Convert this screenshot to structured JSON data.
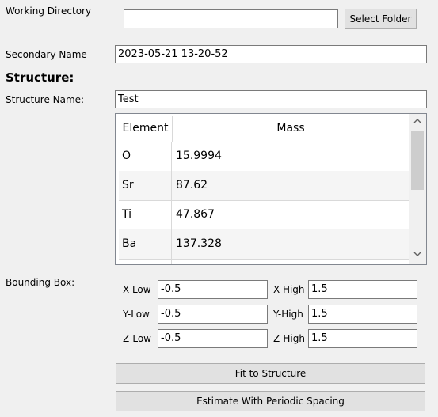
{
  "working_directory": {
    "label": "Working Directory",
    "value": "",
    "button": "Select Folder"
  },
  "secondary_name": {
    "label": "Secondary Name",
    "value": "2023-05-21 13-20-52"
  },
  "structure": {
    "heading": "Structure:",
    "name_label": "Structure Name:",
    "name_value": "Test",
    "table": {
      "headers": [
        "Element",
        "Mass"
      ],
      "rows": [
        {
          "element": "O",
          "mass": "15.9994"
        },
        {
          "element": "Sr",
          "mass": "87.62"
        },
        {
          "element": "Ti",
          "mass": "47.867"
        },
        {
          "element": "Ba",
          "mass": "137.328"
        }
      ],
      "icons": {
        "up": "chevron-up-icon",
        "down": "chevron-down-icon"
      }
    }
  },
  "bounding_box": {
    "label": "Bounding Box:",
    "x_low_label": "X-Low",
    "x_low": "-0.5",
    "x_high_label": "X-High",
    "x_high": "1.5",
    "y_low_label": "Y-Low",
    "y_low": "-0.5",
    "y_high_label": "Y-High",
    "y_high": "1.5",
    "z_low_label": "Z-Low",
    "z_low": "-0.5",
    "z_high_label": "Z-High",
    "z_high": "1.5"
  },
  "buttons": {
    "fit": "Fit to Structure",
    "estimate": "Estimate With Periodic Spacing"
  }
}
